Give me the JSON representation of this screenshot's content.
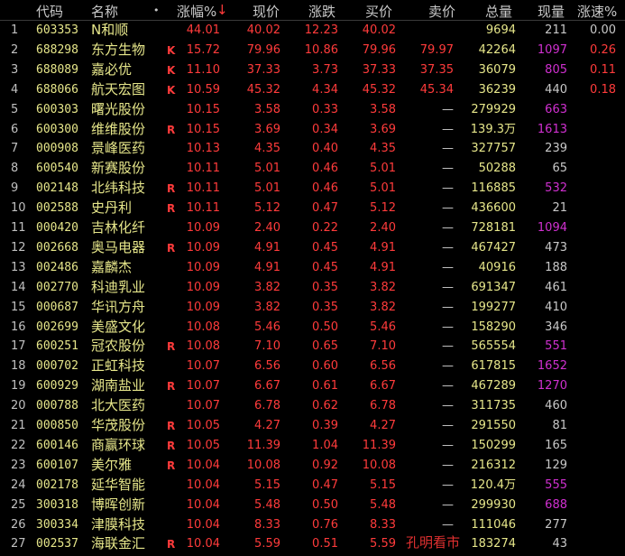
{
  "header": {
    "code": "代码",
    "name": "名称",
    "dot": "•",
    "pct": "涨幅%",
    "arrow": "↓",
    "current": "现价",
    "change": "涨跌",
    "bid": "买价",
    "ask": "卖价",
    "total_vol": "总量",
    "now_vol": "现量",
    "speed": "涨速%"
  },
  "rows": [
    {
      "idx": "1",
      "code": "603353",
      "name": "N和顺",
      "mark": "",
      "pct": "44.01",
      "cur": "40.02",
      "chg": "12.23",
      "bid": "40.02",
      "ask": "",
      "vol": "9694",
      "now": "211",
      "now_color": "dim",
      "spd": "0.00",
      "spd_color": "dim"
    },
    {
      "idx": "2",
      "code": "688298",
      "name": "东方生物",
      "mark": "K",
      "pct": "15.72",
      "cur": "79.96",
      "chg": "10.86",
      "bid": "79.96",
      "ask": "79.97",
      "vol": "42264",
      "now": "1097",
      "now_color": "pur",
      "spd": "0.26",
      "spd_color": "red"
    },
    {
      "idx": "3",
      "code": "688089",
      "name": "嘉必优",
      "mark": "K",
      "pct": "11.10",
      "cur": "37.33",
      "chg": "3.73",
      "bid": "37.33",
      "ask": "37.35",
      "vol": "36079",
      "now": "805",
      "now_color": "pur",
      "spd": "0.11",
      "spd_color": "red"
    },
    {
      "idx": "4",
      "code": "688066",
      "name": "航天宏图",
      "mark": "K",
      "pct": "10.59",
      "cur": "45.32",
      "chg": "4.34",
      "bid": "45.32",
      "ask": "45.34",
      "vol": "36239",
      "now": "440",
      "now_color": "dim",
      "spd": "0.18",
      "spd_color": "red"
    },
    {
      "idx": "5",
      "code": "600303",
      "name": "曙光股份",
      "mark": "",
      "pct": "10.15",
      "cur": "3.58",
      "chg": "0.33",
      "bid": "3.58",
      "ask": "—",
      "vol": "279929",
      "now": "663",
      "now_color": "pur",
      "spd": "",
      "spd_color": "red"
    },
    {
      "idx": "6",
      "code": "600300",
      "name": "维维股份",
      "mark": "R",
      "pct": "10.15",
      "cur": "3.69",
      "chg": "0.34",
      "bid": "3.69",
      "ask": "—",
      "vol": "139.3万",
      "now": "1613",
      "now_color": "pur",
      "spd": "",
      "spd_color": "red"
    },
    {
      "idx": "7",
      "code": "000908",
      "name": "景峰医药",
      "mark": "",
      "pct": "10.13",
      "cur": "4.35",
      "chg": "0.40",
      "bid": "4.35",
      "ask": "—",
      "vol": "327757",
      "now": "239",
      "now_color": "dim",
      "spd": "",
      "spd_color": "red"
    },
    {
      "idx": "8",
      "code": "600540",
      "name": "新赛股份",
      "mark": "",
      "pct": "10.11",
      "cur": "5.01",
      "chg": "0.46",
      "bid": "5.01",
      "ask": "—",
      "vol": "50288",
      "now": "65",
      "now_color": "dim",
      "spd": "",
      "spd_color": "red"
    },
    {
      "idx": "9",
      "code": "002148",
      "name": "北纬科技",
      "mark": "R",
      "pct": "10.11",
      "cur": "5.01",
      "chg": "0.46",
      "bid": "5.01",
      "ask": "—",
      "vol": "116885",
      "now": "532",
      "now_color": "pur",
      "spd": "",
      "spd_color": "red"
    },
    {
      "idx": "10",
      "code": "002588",
      "name": "史丹利",
      "mark": "R",
      "pct": "10.11",
      "cur": "5.12",
      "chg": "0.47",
      "bid": "5.12",
      "ask": "—",
      "vol": "436600",
      "now": "21",
      "now_color": "dim",
      "spd": "",
      "spd_color": "red"
    },
    {
      "idx": "11",
      "code": "000420",
      "name": "吉林化纤",
      "mark": "",
      "pct": "10.09",
      "cur": "2.40",
      "chg": "0.22",
      "bid": "2.40",
      "ask": "—",
      "vol": "728181",
      "now": "1094",
      "now_color": "pur",
      "spd": "",
      "spd_color": "red"
    },
    {
      "idx": "12",
      "code": "002668",
      "name": "奥马电器",
      "mark": "R",
      "pct": "10.09",
      "cur": "4.91",
      "chg": "0.45",
      "bid": "4.91",
      "ask": "—",
      "vol": "467427",
      "now": "473",
      "now_color": "dim",
      "spd": "",
      "spd_color": "red"
    },
    {
      "idx": "13",
      "code": "002486",
      "name": "嘉麟杰",
      "mark": "",
      "pct": "10.09",
      "cur": "4.91",
      "chg": "0.45",
      "bid": "4.91",
      "ask": "—",
      "vol": "40916",
      "now": "188",
      "now_color": "dim",
      "spd": "",
      "spd_color": "red"
    },
    {
      "idx": "14",
      "code": "002770",
      "name": "科迪乳业",
      "mark": "",
      "pct": "10.09",
      "cur": "3.82",
      "chg": "0.35",
      "bid": "3.82",
      "ask": "—",
      "vol": "691347",
      "now": "461",
      "now_color": "dim",
      "spd": "",
      "spd_color": "red"
    },
    {
      "idx": "15",
      "code": "000687",
      "name": "华讯方舟",
      "mark": "",
      "pct": "10.09",
      "cur": "3.82",
      "chg": "0.35",
      "bid": "3.82",
      "ask": "—",
      "vol": "199277",
      "now": "410",
      "now_color": "dim",
      "spd": "",
      "spd_color": "red"
    },
    {
      "idx": "16",
      "code": "002699",
      "name": "美盛文化",
      "mark": "",
      "pct": "10.08",
      "cur": "5.46",
      "chg": "0.50",
      "bid": "5.46",
      "ask": "—",
      "vol": "158290",
      "now": "346",
      "now_color": "dim",
      "spd": "",
      "spd_color": "red"
    },
    {
      "idx": "17",
      "code": "600251",
      "name": "冠农股份",
      "mark": "R",
      "pct": "10.08",
      "cur": "7.10",
      "chg": "0.65",
      "bid": "7.10",
      "ask": "—",
      "vol": "565554",
      "now": "551",
      "now_color": "pur",
      "spd": "",
      "spd_color": "red"
    },
    {
      "idx": "18",
      "code": "000702",
      "name": "正虹科技",
      "mark": "",
      "pct": "10.07",
      "cur": "6.56",
      "chg": "0.60",
      "bid": "6.56",
      "ask": "—",
      "vol": "617815",
      "now": "1652",
      "now_color": "pur",
      "spd": "",
      "spd_color": "red"
    },
    {
      "idx": "19",
      "code": "600929",
      "name": "湖南盐业",
      "mark": "R",
      "pct": "10.07",
      "cur": "6.67",
      "chg": "0.61",
      "bid": "6.67",
      "ask": "—",
      "vol": "467289",
      "now": "1270",
      "now_color": "pur",
      "spd": "",
      "spd_color": "red"
    },
    {
      "idx": "20",
      "code": "000788",
      "name": "北大医药",
      "mark": "",
      "pct": "10.07",
      "cur": "6.78",
      "chg": "0.62",
      "bid": "6.78",
      "ask": "—",
      "vol": "311735",
      "now": "460",
      "now_color": "dim",
      "spd": "",
      "spd_color": "red"
    },
    {
      "idx": "21",
      "code": "000850",
      "name": "华茂股份",
      "mark": "R",
      "pct": "10.05",
      "cur": "4.27",
      "chg": "0.39",
      "bid": "4.27",
      "ask": "—",
      "vol": "291550",
      "now": "81",
      "now_color": "dim",
      "spd": "",
      "spd_color": "red"
    },
    {
      "idx": "22",
      "code": "600146",
      "name": "商赢环球",
      "mark": "R",
      "pct": "10.05",
      "cur": "11.39",
      "chg": "1.04",
      "bid": "11.39",
      "ask": "—",
      "vol": "150299",
      "now": "165",
      "now_color": "dim",
      "spd": "",
      "spd_color": "red"
    },
    {
      "idx": "23",
      "code": "600107",
      "name": "美尔雅",
      "mark": "R",
      "pct": "10.04",
      "cur": "10.08",
      "chg": "0.92",
      "bid": "10.08",
      "ask": "—",
      "vol": "216312",
      "now": "129",
      "now_color": "dim",
      "spd": "",
      "spd_color": "red"
    },
    {
      "idx": "24",
      "code": "002178",
      "name": "延华智能",
      "mark": "",
      "pct": "10.04",
      "cur": "5.15",
      "chg": "0.47",
      "bid": "5.15",
      "ask": "—",
      "vol": "120.4万",
      "now": "555",
      "now_color": "pur",
      "spd": "",
      "spd_color": "red"
    },
    {
      "idx": "25",
      "code": "300318",
      "name": "博晖创新",
      "mark": "",
      "pct": "10.04",
      "cur": "5.48",
      "chg": "0.50",
      "bid": "5.48",
      "ask": "—",
      "vol": "299930",
      "now": "688",
      "now_color": "pur",
      "spd": "",
      "spd_color": "red"
    },
    {
      "idx": "26",
      "code": "300334",
      "name": "津膜科技",
      "mark": "",
      "pct": "10.04",
      "cur": "8.33",
      "chg": "0.76",
      "bid": "8.33",
      "ask": "—",
      "vol": "111046",
      "now": "277",
      "now_color": "dim",
      "spd": "",
      "spd_color": "red"
    },
    {
      "idx": "27",
      "code": "002537",
      "name": "海联金汇",
      "mark": "R",
      "pct": "10.04",
      "cur": "5.59",
      "chg": "0.51",
      "bid": "5.59",
      "ask": "",
      "vol": "183274",
      "now": "43",
      "now_color": "dim",
      "spd": "",
      "spd_color": "red"
    }
  ],
  "watermark": "孔明看市"
}
